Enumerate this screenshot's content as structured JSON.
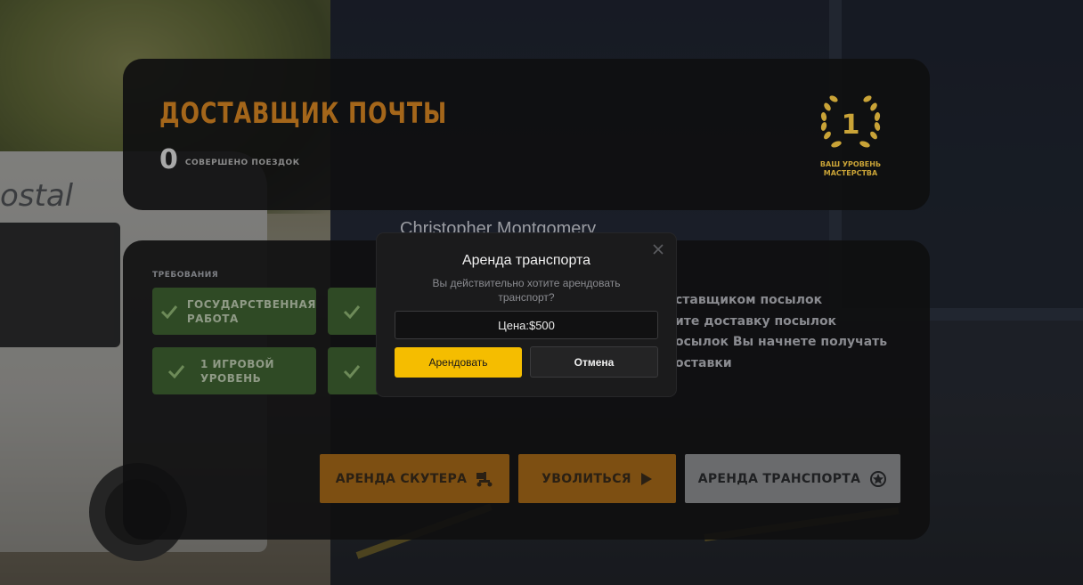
{
  "header": {
    "job_title": "ДОСТАВЩИК ПОЧТЫ",
    "trips_count": "0",
    "trips_label": "СОВЕРШЕНО ПОЕЗДОК",
    "mastery_level": "1",
    "mastery_label": "ВАШ УРОВЕНЬ\nМАСТЕРСТВА"
  },
  "background": {
    "truck_logo": "ostal"
  },
  "player": {
    "name": "Christopher Montgomery"
  },
  "requirements": {
    "title": "ТРЕБОВАНИЯ",
    "items": [
      {
        "label": "ГОСУДАРСТВЕННАЯ\nРАБОТА"
      },
      {
        "label": "1 ИГРОВОЙ\nУРОВЕНЬ"
      },
      {
        "label": ""
      },
      {
        "label": ""
      }
    ]
  },
  "description": {
    "lines": [
      "ставщиком посылок",
      "ите доставку посылок",
      "осылок Вы начнете получать",
      "оставки"
    ]
  },
  "actions": {
    "rent_scooter": "АРЕНДА СКУТЕРА",
    "quit": "УВОЛИТЬСЯ",
    "rent_transport": "АРЕНДА ТРАНСПОРТА"
  },
  "modal": {
    "title": "Аренда транспорта",
    "text": "Вы действительно хотите арендовать транспорт?",
    "price": "Цена:$500",
    "confirm": "Арендовать",
    "cancel": "Отмена"
  },
  "colors": {
    "accent_orange": "#a4661a",
    "button_yellow": "#f5bd00",
    "requirement_green": "#2f4a25",
    "mastery_gold": "#c9a337"
  }
}
